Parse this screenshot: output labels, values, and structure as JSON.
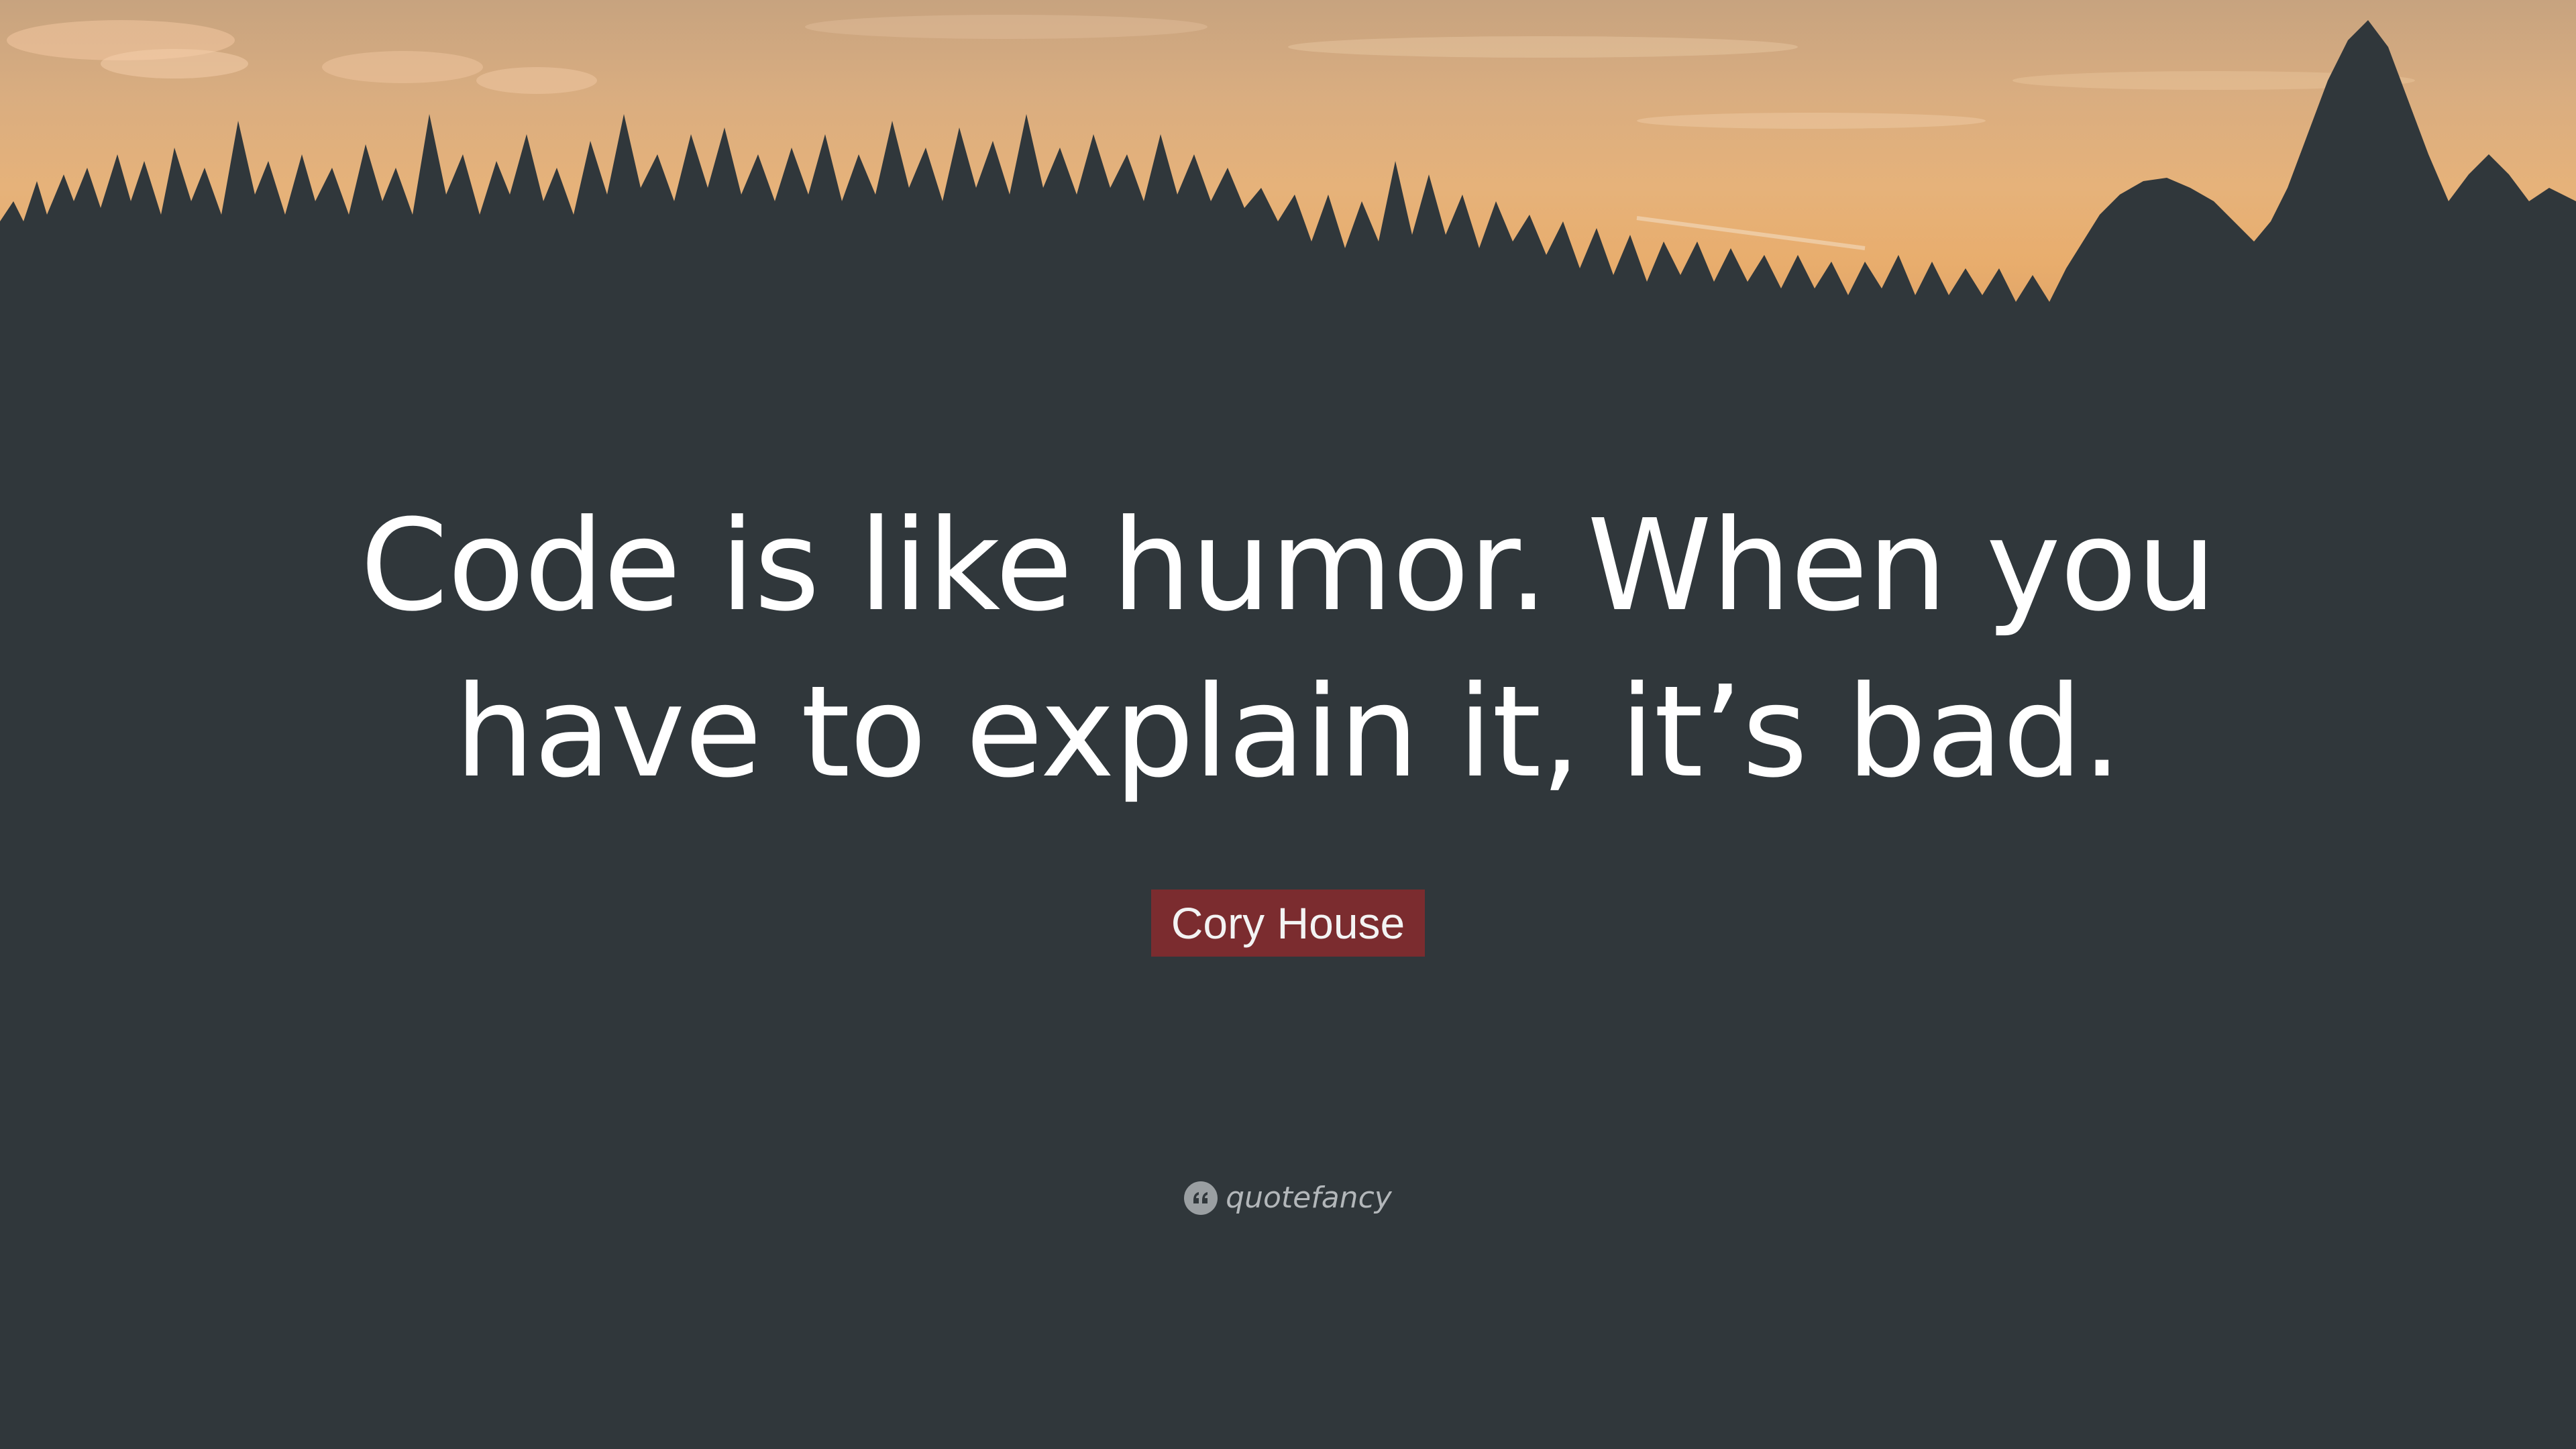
{
  "quote": {
    "text": "Code is like humor. When you have to explain it, it’s bad.",
    "author": "Cory House"
  },
  "brand": {
    "name": "quotefancy",
    "icon": "quote-marks-icon"
  },
  "colors": {
    "background": "#30373b",
    "sky_top": "#c7a37f",
    "sky_bottom": "#e8ad6d",
    "author_badge": "#7b2c2f",
    "quote_text": "#ffffff",
    "brand_text": "#b3b7ba"
  }
}
